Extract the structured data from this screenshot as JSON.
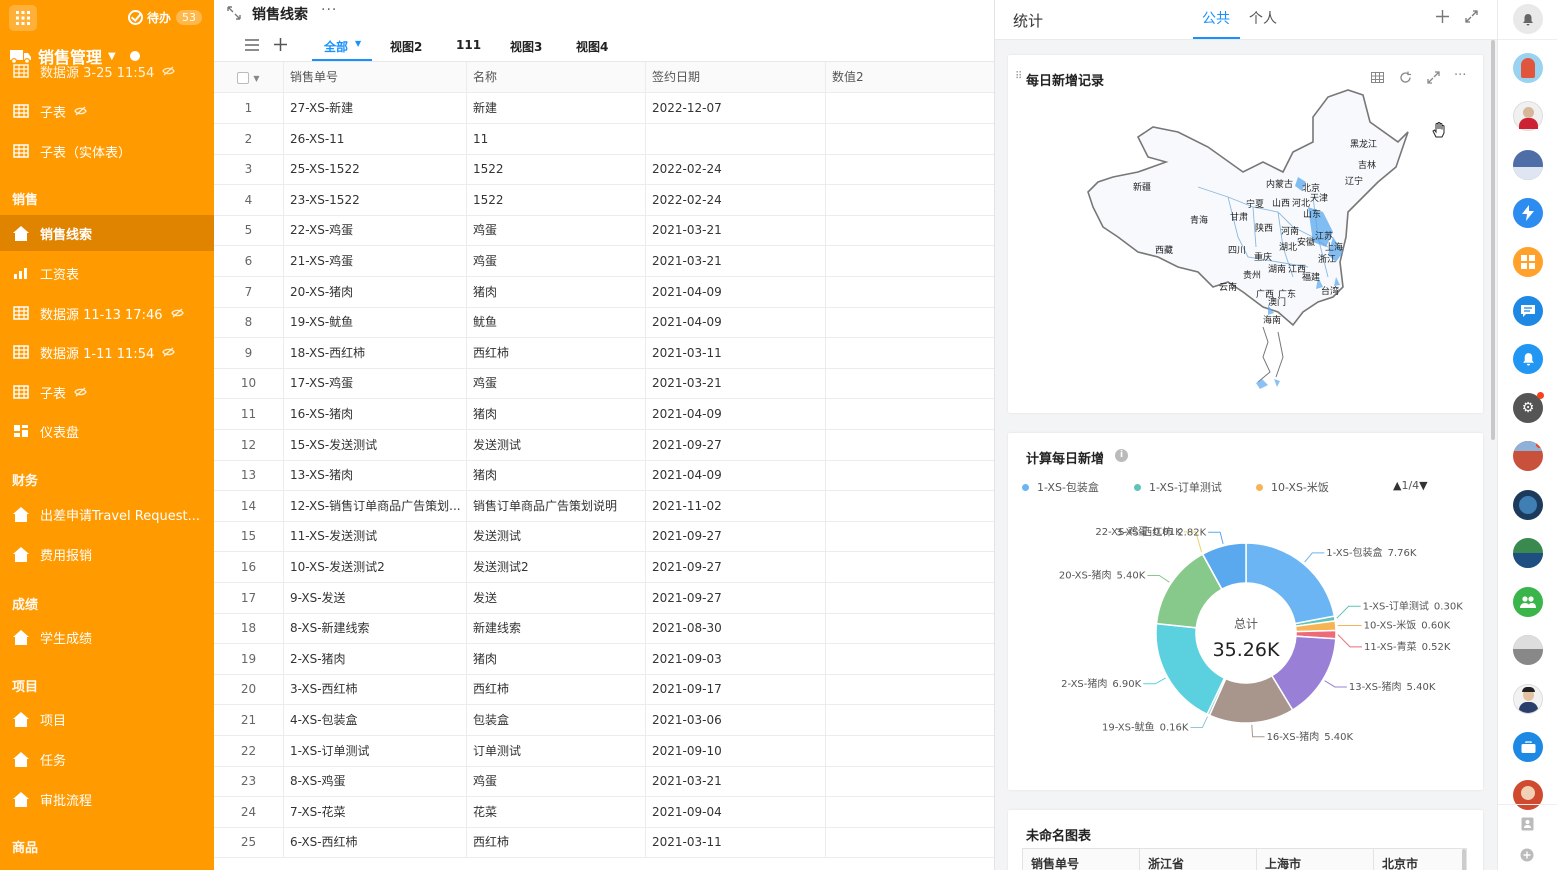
{
  "sidebar": {
    "todo_label": "待办",
    "todo_count": "53",
    "app_name": "销售管理",
    "items_top": [
      {
        "label": "数据源 3-25 11:54",
        "icon": "table-icon",
        "hidden": true
      },
      {
        "label": "子表",
        "icon": "table-icon",
        "hidden": true
      },
      {
        "label": "子表（实体表）",
        "icon": "table-icon",
        "hidden": false
      }
    ],
    "sections": [
      {
        "title": "销售"
      },
      {
        "title": "财务"
      },
      {
        "title": "成绩"
      },
      {
        "title": "项目"
      },
      {
        "title": "商品"
      }
    ],
    "sales_items": [
      {
        "label": "销售线索"
      },
      {
        "label": "工资表"
      },
      {
        "label": "数据源 11-13 17:46"
      },
      {
        "label": "数据源 1-11 11:54"
      },
      {
        "label": "子表"
      },
      {
        "label": "仪表盘"
      }
    ],
    "finance_items": [
      {
        "label": "出差申请Travel Request..."
      },
      {
        "label": "费用报销"
      }
    ],
    "grade_items": [
      {
        "label": "学生成绩"
      }
    ],
    "project_items": [
      {
        "label": "项目"
      },
      {
        "label": "任务"
      },
      {
        "label": "审批流程"
      }
    ]
  },
  "main": {
    "title": "销售线索",
    "more": "···",
    "views": [
      "全部",
      "视图2",
      "111",
      "视图3",
      "视图4"
    ],
    "columns": [
      "销售单号",
      "名称",
      "签约日期",
      "数值2"
    ],
    "rows": [
      [
        "1",
        "27-XS-新建",
        "新建",
        "2022-12-07"
      ],
      [
        "2",
        "26-XS-11",
        "11",
        ""
      ],
      [
        "3",
        "25-XS-1522",
        "1522",
        "2022-02-24"
      ],
      [
        "4",
        "23-XS-1522",
        "1522",
        "2022-02-24"
      ],
      [
        "5",
        "22-XS-鸡蛋",
        "鸡蛋",
        "2021-03-21"
      ],
      [
        "6",
        "21-XS-鸡蛋",
        "鸡蛋",
        "2021-03-21"
      ],
      [
        "7",
        "20-XS-猪肉",
        "猪肉",
        "2021-04-09"
      ],
      [
        "8",
        "19-XS-鱿鱼",
        "鱿鱼",
        "2021-04-09"
      ],
      [
        "9",
        "18-XS-西红柿",
        "西红柿",
        "2021-03-11"
      ],
      [
        "10",
        "17-XS-鸡蛋",
        "鸡蛋",
        "2021-03-21"
      ],
      [
        "11",
        "16-XS-猪肉",
        "猪肉",
        "2021-04-09"
      ],
      [
        "12",
        "15-XS-发送测试",
        "发送测试",
        "2021-09-27"
      ],
      [
        "13",
        "13-XS-猪肉",
        "猪肉",
        "2021-04-09"
      ],
      [
        "14",
        "12-XS-销售订单商品广告策划...",
        "销售订单商品广告策划说明",
        "2021-11-02"
      ],
      [
        "15",
        "11-XS-发送测试",
        "发送测试",
        "2021-09-27"
      ],
      [
        "16",
        "10-XS-发送测试2",
        "发送测试2",
        "2021-09-27"
      ],
      [
        "17",
        "9-XS-发送",
        "发送",
        "2021-09-27"
      ],
      [
        "18",
        "8-XS-新建线索",
        "新建线索",
        "2021-08-30"
      ],
      [
        "19",
        "2-XS-猪肉",
        "猪肉",
        "2021-09-03"
      ],
      [
        "20",
        "3-XS-西红柿",
        "西红柿",
        "2021-09-17"
      ],
      [
        "21",
        "4-XS-包装盒",
        "包装盒",
        "2021-03-06"
      ],
      [
        "22",
        "1-XS-订单测试",
        "订单测试",
        "2021-09-10"
      ],
      [
        "23",
        "8-XS-鸡蛋",
        "鸡蛋",
        "2021-03-21"
      ],
      [
        "24",
        "7-XS-花菜",
        "花菜",
        "2021-09-04"
      ],
      [
        "25",
        "6-XS-西红柿",
        "西红柿",
        "2021-03-11"
      ]
    ]
  },
  "panel": {
    "title": "统计",
    "tab_public": "公共",
    "tab_private": "个人",
    "map_card": {
      "title": "每日新增记录",
      "provinces": [
        "黑龙江",
        "吉林",
        "辽宁",
        "内蒙古",
        "北京",
        "天津",
        "河北",
        "山西",
        "宁夏",
        "甘肃",
        "陕西",
        "山东",
        "河南",
        "新疆",
        "青海",
        "西藏",
        "四川",
        "重庆",
        "湖北",
        "安徽",
        "江苏",
        "上海",
        "浙江",
        "湖南",
        "江西",
        "福建",
        "贵州",
        "云南",
        "广西",
        "广东",
        "澳门",
        "台湾",
        "海南"
      ]
    },
    "pie_card": {
      "title": "计算每日新增",
      "legend_pager": "1/4",
      "center_label": "总计",
      "center_value": "35.26K"
    },
    "table_card": {
      "title": "未命名图表",
      "columns": [
        "销售单号",
        "浙江省",
        "上海市",
        "北京市"
      ]
    }
  },
  "chart_data": {
    "type": "pie",
    "title": "计算每日新增",
    "total": 35.26,
    "unit": "K",
    "legend_visible": [
      "1-XS-包装盒",
      "1-XS-订单测试",
      "10-XS-米饭"
    ],
    "slices": [
      {
        "name": "1-XS-包装盒",
        "value": 7.76,
        "label": "7.76K",
        "color": "#6bb5f5"
      },
      {
        "name": "1-XS-订单测试",
        "value": 0.3,
        "label": "0.30K",
        "color": "#5fc4b8"
      },
      {
        "name": "10-XS-米饭",
        "value": 0.6,
        "label": "0.60K",
        "color": "#f6b454"
      },
      {
        "name": "11-XS-青菜",
        "value": 0.52,
        "label": "0.52K",
        "color": "#ee6a78"
      },
      {
        "name": "13-XS-猪肉",
        "value": 5.4,
        "label": "5.40K",
        "color": "#9a7fd6"
      },
      {
        "name": "16-XS-猪肉",
        "value": 5.4,
        "label": "5.40K",
        "color": "#a8968d"
      },
      {
        "name": "19-XS-鱿鱼",
        "value": 0.16,
        "label": "0.16K",
        "color": "#8ec9d4"
      },
      {
        "name": "2-XS-猪肉",
        "value": 6.9,
        "label": "6.90K",
        "color": "#5bd1e0"
      },
      {
        "name": "20-XS-猪肉",
        "value": 5.4,
        "label": "5.40K",
        "color": "#86c98a"
      },
      {
        "name": "22-XS-鸡蛋",
        "value": 0.01,
        "label": "0.01K",
        "color": "#e8d46a"
      },
      {
        "name": "3-XS-西红柿",
        "value": 2.82,
        "label": "2.82K",
        "color": "#5aa8ee"
      }
    ]
  },
  "colors": {
    "sidebar": "#ff9a00",
    "sidebar_active": "#e08400",
    "accent": "#1890ff"
  }
}
